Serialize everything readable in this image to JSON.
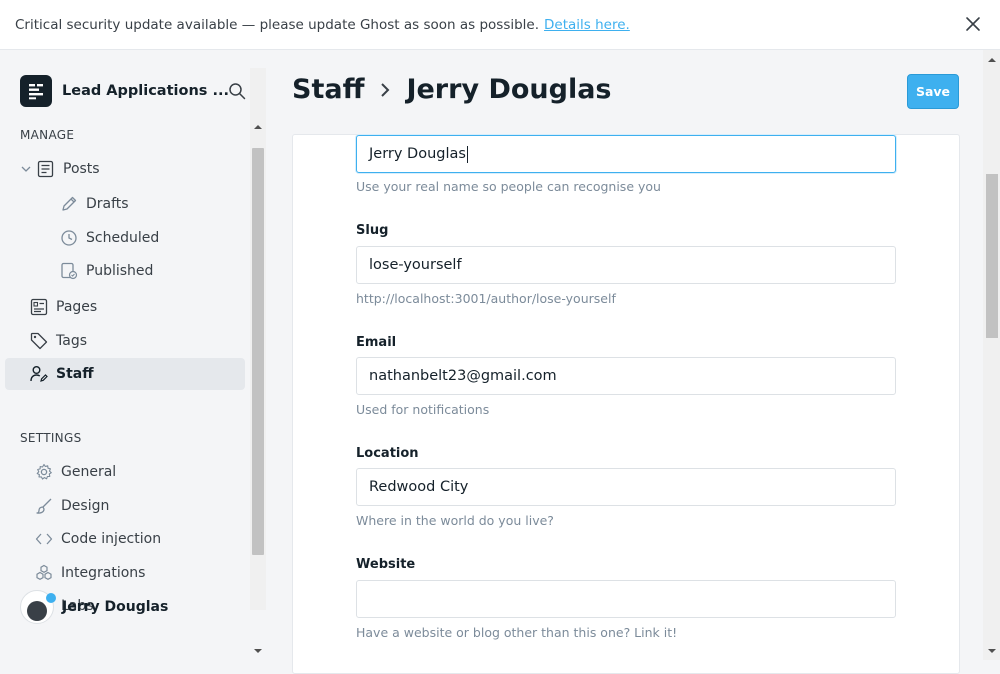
{
  "banner": {
    "message": "Critical security update available — please update Ghost as soon as possible.",
    "link": "Details here."
  },
  "sidebar": {
    "site_name": "Lead Applications ...",
    "manage_label": "MANAGE",
    "settings_label": "SETTINGS",
    "posts": "Posts",
    "drafts": "Drafts",
    "scheduled": "Scheduled",
    "published": "Published",
    "pages": "Pages",
    "tags": "Tags",
    "staff": "Staff",
    "general": "General",
    "design": "Design",
    "code_injection": "Code injection",
    "integrations": "Integrations",
    "labs": "Labs",
    "user_name": "Jerry Douglas"
  },
  "header": {
    "crumb_parent": "Staff",
    "crumb_current": "Jerry Douglas",
    "save_label": "Save"
  },
  "form": {
    "name_value": "Jerry Douglas",
    "name_help": "Use your real name so people can recognise you",
    "slug_label": "Slug",
    "slug_value": "lose-yourself",
    "slug_help": "http://localhost:3001/author/lose-yourself",
    "email_label": "Email",
    "email_value": "nathanbelt23@gmail.com",
    "email_help": "Used for notifications",
    "location_label": "Location",
    "location_value": "Redwood City",
    "location_help": "Where in the world do you live?",
    "website_label": "Website",
    "website_value": "",
    "website_help": "Have a website or blog other than this one? Link it!"
  },
  "colors": {
    "accent": "#3eb0ef",
    "text": "#15212a",
    "muted": "#7c8b9a"
  }
}
